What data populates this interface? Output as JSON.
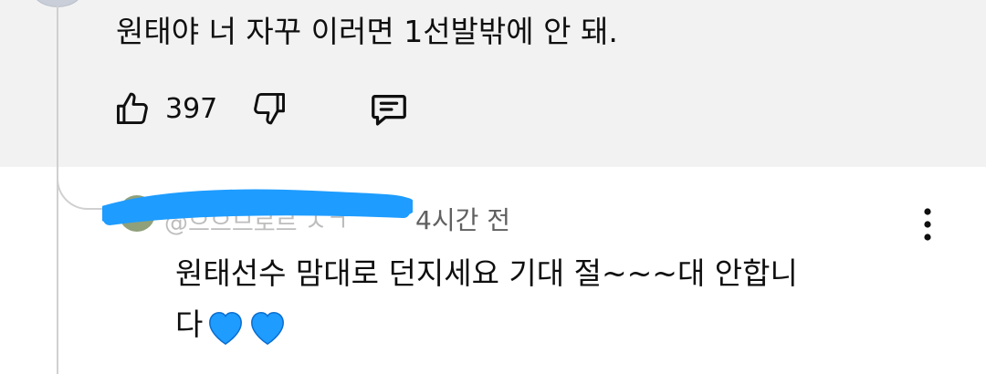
{
  "parent_comment": {
    "text": "원태야 너 자꾸 이러면 1선발밖에 안 돼.",
    "likes": "397",
    "icons": [
      "thumbs-up-icon",
      "thumbs-down-icon",
      "reply-comment-icon"
    ]
  },
  "reply": {
    "author_handle": "@으으므로르 ㅅㄱ",
    "time": "4시간 전",
    "text": "원태선수 맘대로 던지세요 기대 절~~~대 안합니다",
    "emoji": [
      "blue-heart",
      "blue-heart"
    ],
    "menu_icon": "more-vert-icon"
  },
  "colors": {
    "parent_bg": "#f2f2f2",
    "text": "#0f0f0f",
    "secondary_text": "#606060",
    "thread_line": "#d0d0d0",
    "redaction": "#1e9cff",
    "heart": "#1e9cff"
  }
}
